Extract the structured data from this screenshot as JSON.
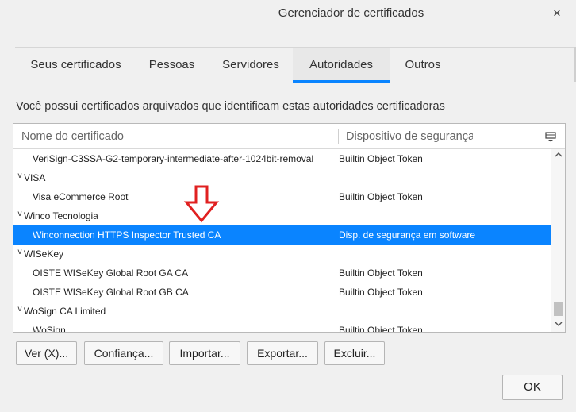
{
  "window": {
    "title": "Gerenciador de certificados",
    "close_label": "×"
  },
  "tabs": [
    {
      "label": "Seus certificados"
    },
    {
      "label": "Pessoas"
    },
    {
      "label": "Servidores"
    },
    {
      "label": "Autoridades"
    },
    {
      "label": "Outros"
    }
  ],
  "active_tab": "Autoridades",
  "description": "Você possui certificados arquivados que identificam estas autoridades certificadoras",
  "table": {
    "columns": [
      "Nome do certificado",
      "Dispositivo de segurança"
    ],
    "column_picker_icon": "column-picker-icon",
    "rows": [
      {
        "type": "cert",
        "name": "VeriSign-C3SSA-G2-temporary-intermediate-after-1024bit-removal",
        "device": "Builtin Object Token"
      },
      {
        "type": "group",
        "name": "VISA",
        "expander": "v"
      },
      {
        "type": "cert",
        "name": "Visa eCommerce Root",
        "device": "Builtin Object Token"
      },
      {
        "type": "group",
        "name": "Winco Tecnologia",
        "expander": "v"
      },
      {
        "type": "cert",
        "name": "Winconnection HTTPS Inspector Trusted CA",
        "device": "Disp. de segurança em software",
        "selected": true
      },
      {
        "type": "group",
        "name": "WISeKey",
        "expander": "v"
      },
      {
        "type": "cert",
        "name": "OISTE WISeKey Global Root GA CA",
        "device": "Builtin Object Token"
      },
      {
        "type": "cert",
        "name": "OISTE WISeKey Global Root GB CA",
        "device": "Builtin Object Token"
      },
      {
        "type": "group",
        "name": "WoSign CA Limited",
        "expander": "v"
      },
      {
        "type": "cert",
        "name": "WoSign",
        "device": "Builtin Object Token"
      }
    ]
  },
  "buttons": {
    "view": "Ver (X)...",
    "trust": "Confiança...",
    "import": "Importar...",
    "export": "Exportar...",
    "delete": "Excluir...",
    "ok": "OK"
  },
  "colors": {
    "accent": "#0a84ff",
    "annotation_arrow": "#e02020"
  }
}
